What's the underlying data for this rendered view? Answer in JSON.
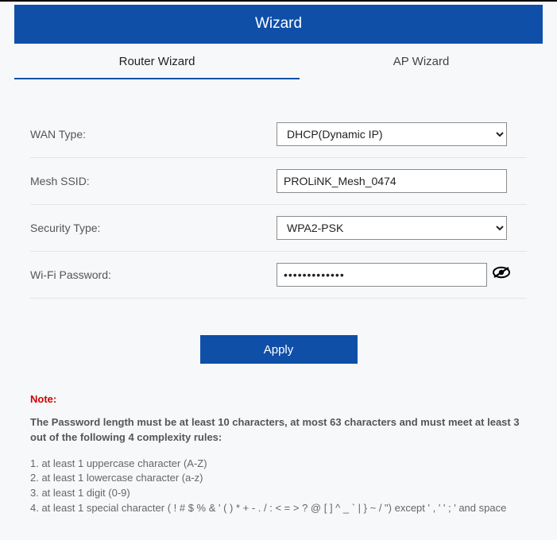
{
  "header": {
    "title": "Wizard"
  },
  "tabs": {
    "router": "Router Wizard",
    "ap": "AP Wizard"
  },
  "form": {
    "wan_type": {
      "label": "WAN Type:",
      "value": "DHCP(Dynamic IP)"
    },
    "mesh_ssid": {
      "label": "Mesh SSID:",
      "value": "PROLiNK_Mesh_0474"
    },
    "security_type": {
      "label": "Security Type:",
      "value": "WPA2-PSK"
    },
    "wifi_password": {
      "label": "Wi-Fi Password:",
      "value": "•••••••••••••"
    }
  },
  "buttons": {
    "apply": "Apply"
  },
  "note": {
    "title": "Note:",
    "intro": "The Password length must be at least 10 characters, at most 63 characters and must meet at least 3 out of the following 4 complexity rules:",
    "rule1": "1. at least 1 uppercase character (A-Z)",
    "rule2": "2. at least 1 lowercase character (a-z)",
    "rule3": "3. at least 1 digit (0-9)",
    "rule4": "4. at least 1 special character ( ! # $ % & ' ( ) * + - . / : < = > ? @ [ ] ^ _ ` | } ~ / \") except ' , ' ' ; ' and space"
  }
}
